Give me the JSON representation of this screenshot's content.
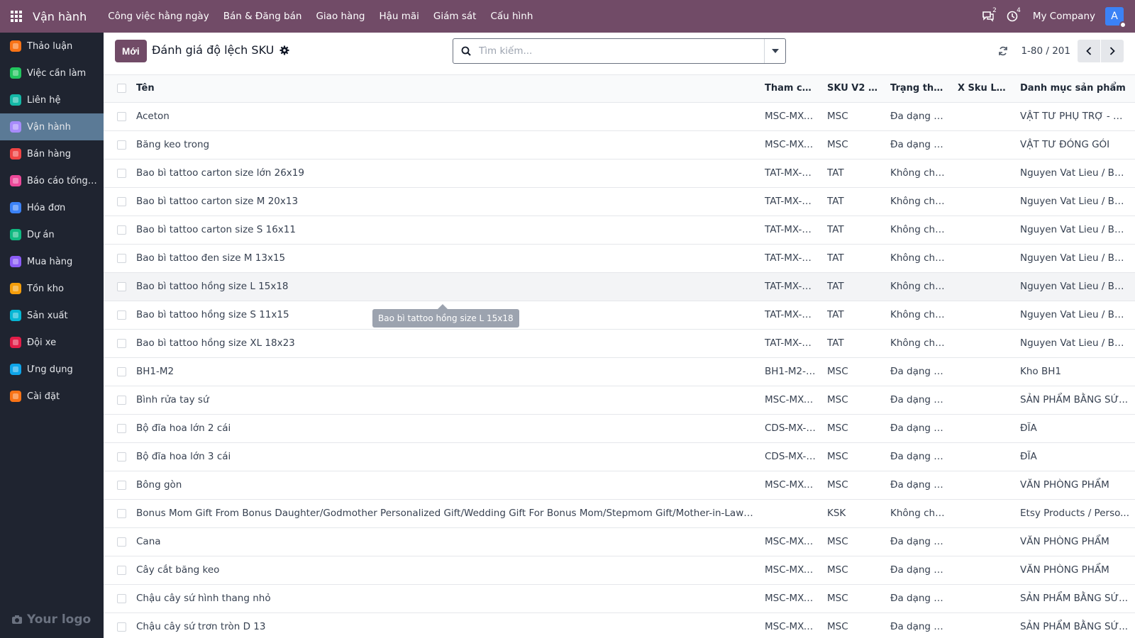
{
  "navbar": {
    "app_name": "Vận hành",
    "menu": [
      "Công việc hằng ngày",
      "Bán & Đăng bán",
      "Giao hàng",
      "Hậu mãi",
      "Giám sát",
      "Cấu hình"
    ],
    "messages_count": "2",
    "activities_count": "4",
    "company": "My Company",
    "avatar_letter": "A"
  },
  "sidebar": {
    "items": [
      {
        "label": "Thảo luận",
        "icon": "discuss-icon",
        "color": "#f97316"
      },
      {
        "label": "Việc cần làm",
        "icon": "todo-icon",
        "color": "#22c55e"
      },
      {
        "label": "Liên hệ",
        "icon": "contacts-icon",
        "color": "#14b8a6"
      },
      {
        "label": "Vận hành",
        "icon": "operations-icon",
        "color": "#a78bfa",
        "active": true
      },
      {
        "label": "Bán hàng",
        "icon": "sales-icon",
        "color": "#ef4444"
      },
      {
        "label": "Báo cáo tổng hợp",
        "icon": "reports-icon",
        "color": "#ec4899"
      },
      {
        "label": "Hóa đơn",
        "icon": "invoice-icon",
        "color": "#3b82f6"
      },
      {
        "label": "Dự án",
        "icon": "project-icon",
        "color": "#10b981"
      },
      {
        "label": "Mua hàng",
        "icon": "purchase-icon",
        "color": "#8b5cf6"
      },
      {
        "label": "Tồn kho",
        "icon": "inventory-icon",
        "color": "#f59e0b"
      },
      {
        "label": "Sản xuất",
        "icon": "manufacturing-icon",
        "color": "#06b6d4"
      },
      {
        "label": "Đội xe",
        "icon": "fleet-icon",
        "color": "#e11d48"
      },
      {
        "label": "Ứng dụng",
        "icon": "apps-icon",
        "color": "#0ea5e9"
      },
      {
        "label": "Cài đặt",
        "icon": "settings-icon",
        "color": "#f97316"
      }
    ],
    "logo_text": "Your logo"
  },
  "control": {
    "new_label": "Mới",
    "title": "Đánh giá độ lệch SKU",
    "search_placeholder": "Tìm kiếm...",
    "pager": "1-80 / 201"
  },
  "table": {
    "columns": [
      "Tên",
      "Tham chi...",
      "SKU V2 đ...",
      "Trạng thái ...",
      "X Sku Leg...",
      "Danh mục sản phẩm"
    ],
    "rows": [
      [
        "Aceton",
        "MSC-MX-S...",
        "MSC",
        "Đa dạng b...",
        "",
        "VẬT TƯ PHỤ TRỢ - ĐĨA"
      ],
      [
        "Băng keo trong",
        "MSC-MX-S...",
        "MSC",
        "Đa dạng b...",
        "",
        "VẬT TƯ ĐÓNG GÓI"
      ],
      [
        "Bao bì tattoo carton size lớn 26x19",
        "TAT-MX-S...",
        "TAT",
        "Không chín...",
        "",
        "Nguyen Vat Lieu / BA..."
      ],
      [
        "Bao bì tattoo carton size M 20x13",
        "TAT-MX-S...",
        "TAT",
        "Không chín...",
        "",
        "Nguyen Vat Lieu / BA..."
      ],
      [
        "Bao bì tattoo carton size S 16x11",
        "TAT-MX-S...",
        "TAT",
        "Không chín...",
        "",
        "Nguyen Vat Lieu / BA..."
      ],
      [
        "Bao bì tattoo đen size M 13x15",
        "TAT-MX-S...",
        "TAT",
        "Không chín...",
        "",
        "Nguyen Vat Lieu / BA..."
      ],
      [
        "Bao bì tattoo hồng size L 15x18",
        "TAT-MX-S...",
        "TAT",
        "Không chín...",
        "",
        "Nguyen Vat Lieu / BA..."
      ],
      [
        "Bao bì tattoo hồng size S 11x15",
        "TAT-MX-S...",
        "TAT",
        "Không chín...",
        "",
        "Nguyen Vat Lieu / BA..."
      ],
      [
        "Bao bì tattoo hồng size XL 18x23",
        "TAT-MX-S...",
        "TAT",
        "Không chín...",
        "",
        "Nguyen Vat Lieu / BA..."
      ],
      [
        "BH1-M2",
        "BH1-M2-S...",
        "MSC",
        "Đa dạng b...",
        "",
        "Kho BH1"
      ],
      [
        "Bình rửa tay sứ",
        "MSC-MX-S...",
        "MSC",
        "Đa dạng b...",
        "",
        "SẢN PHẨM BẰNG SỨ..."
      ],
      [
        "Bộ đĩa hoa lớn 2 cái",
        "CDS-MX-S...",
        "MSC",
        "Đa dạng b...",
        "",
        "ĐĨA"
      ],
      [
        "Bộ đĩa hoa lớn 3 cái",
        "CDS-MX-S...",
        "MSC",
        "Đa dạng b...",
        "",
        "ĐĨA"
      ],
      [
        "Bông gòn",
        "MSC-MX-S...",
        "MSC",
        "Đa dạng b...",
        "",
        "VĂN PHÒNG PHẨM"
      ],
      [
        "Bonus Mom Gift From Bonus Daughter/Godmother Personalized Gift/Wedding Gift For Bonus Mom/Stepmom Gift/Mother-in-Law Gifts...",
        "",
        "KSK",
        "Không chín...",
        "",
        "Etsy Products / Perso..."
      ],
      [
        "Cana",
        "MSC-MX-S...",
        "MSC",
        "Đa dạng b...",
        "",
        "VĂN PHÒNG PHẨM"
      ],
      [
        "Cây cắt băng keo",
        "MSC-MX-S...",
        "MSC",
        "Đa dạng b...",
        "",
        "VĂN PHÒNG PHẨM"
      ],
      [
        "Chậu cây sứ hình thang nhỏ",
        "MSC-MX-S...",
        "MSC",
        "Đa dạng b...",
        "",
        "SẢN PHẨM BẰNG SỨ..."
      ],
      [
        "Chậu cây sứ trơn tròn D 13",
        "MSC-MX-S...",
        "MSC",
        "Đa dạng b...",
        "",
        "SẢN PHẨM BẰNG SỨ..."
      ]
    ],
    "hover_row": 6
  },
  "tooltip": "Bao bì tattoo hồng size L 15x18",
  "colors": {
    "brand": "#714b67",
    "sidebar_bg": "#1f2430",
    "sidebar_active": "#5b7a96"
  }
}
